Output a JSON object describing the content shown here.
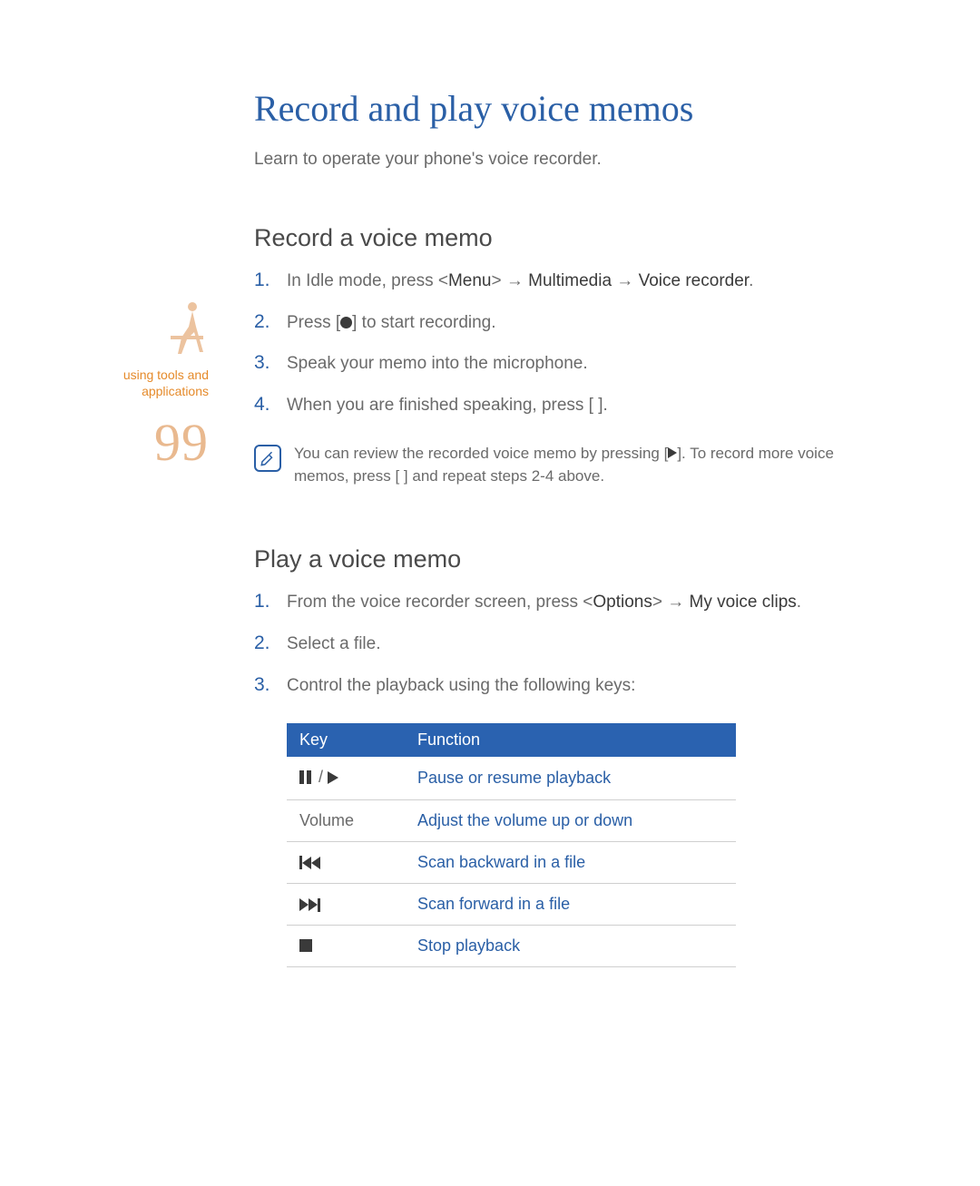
{
  "sidebar": {
    "section_label_line1": "using tools and",
    "section_label_line2": "applications",
    "page_number": "99"
  },
  "title": "Record and play voice memos",
  "intro": "Learn to operate your phone's voice recorder.",
  "section1": {
    "heading": "Record a voice memo",
    "steps": {
      "s1_pre": "In Idle mode, press <",
      "s1_menu": "Menu",
      "s1_mid1": "> → ",
      "s1_multimedia": "Multimedia",
      "s1_mid2": " → ",
      "s1_voice_recorder": "Voice recorder",
      "s1_end": ".",
      "s2_pre": "Press [",
      "s2_post": "] to start recording.",
      "s3": "Speak your memo into the microphone.",
      "s4": "When you are finished speaking, press [  ]."
    },
    "note_line1_pre": "You can review the recorded voice memo by pressing [",
    "note_line1_post": "].",
    "note_line2": "To record more voice memos, press [  ] and repeat steps 2-4 above."
  },
  "section2": {
    "heading": "Play a voice memo",
    "steps": {
      "s1_pre": "From the voice recorder screen, press <",
      "s1_options": "Options",
      "s1_mid": "> → ",
      "s1_myclips": "My voice clips",
      "s1_end": ".",
      "s2": "Select a file.",
      "s3": "Control the playback using the following keys:"
    },
    "table": {
      "header_key": "Key",
      "header_function": "Function",
      "rows": [
        {
          "key_icon": "pause-play",
          "key_text": "",
          "function": "Pause or resume playback"
        },
        {
          "key_icon": "",
          "key_text": "Volume",
          "function": "Adjust the volume up or down"
        },
        {
          "key_icon": "prev",
          "key_text": "",
          "function": "Scan backward in a file"
        },
        {
          "key_icon": "next",
          "key_text": "",
          "function": "Scan forward in a file"
        },
        {
          "key_icon": "stop",
          "key_text": "",
          "function": "Stop playback"
        }
      ]
    }
  },
  "nums": {
    "n1": "1.",
    "n2": "2.",
    "n3": "3.",
    "n4": "4."
  }
}
